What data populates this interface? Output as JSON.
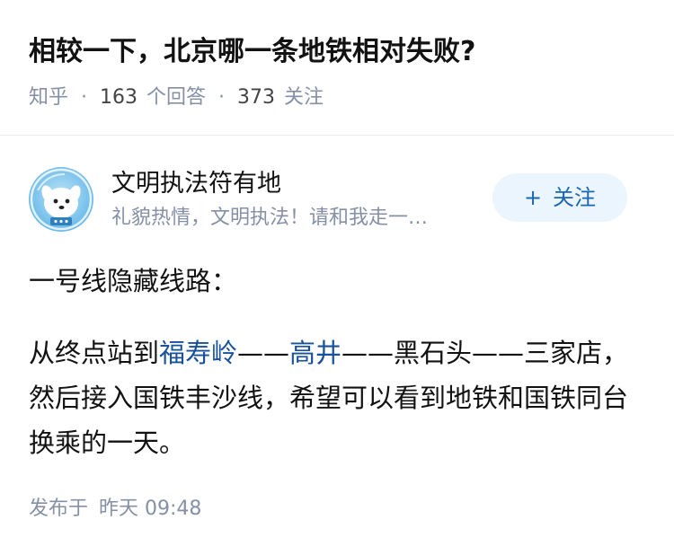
{
  "question": {
    "title": "相较一下，北京哪一条地铁相对失败?",
    "source": "知乎",
    "separator": "·",
    "answer_count": "163",
    "answer_label": "个回答",
    "follower_count": "373",
    "follower_label": "关注"
  },
  "author": {
    "name": "文明执法符有地",
    "bio": "礼貌热情，文明执法！请和我走一…",
    "avatar_icon": "cartoon-dog-astronaut-avatar",
    "follow_icon": "plus-icon",
    "follow_plus": "+",
    "follow_label": "关注"
  },
  "answer": {
    "line1": "一号线隐藏线路：",
    "p2_prefix": "从终点站到",
    "link1": "福寿岭",
    "dash1": "——",
    "link2": "高井",
    "p2_rest": "——黑石头——三家店，然后接入国铁丰沙线，希望可以看到地铁和国铁同台换乘的一天。"
  },
  "publish": {
    "label": "发布于",
    "time": "昨天 09:48"
  },
  "colors": {
    "link": "#175199",
    "meta": "#8590a6",
    "follow_bg": "#ebf5fd",
    "follow_text": "#1a66b3"
  }
}
